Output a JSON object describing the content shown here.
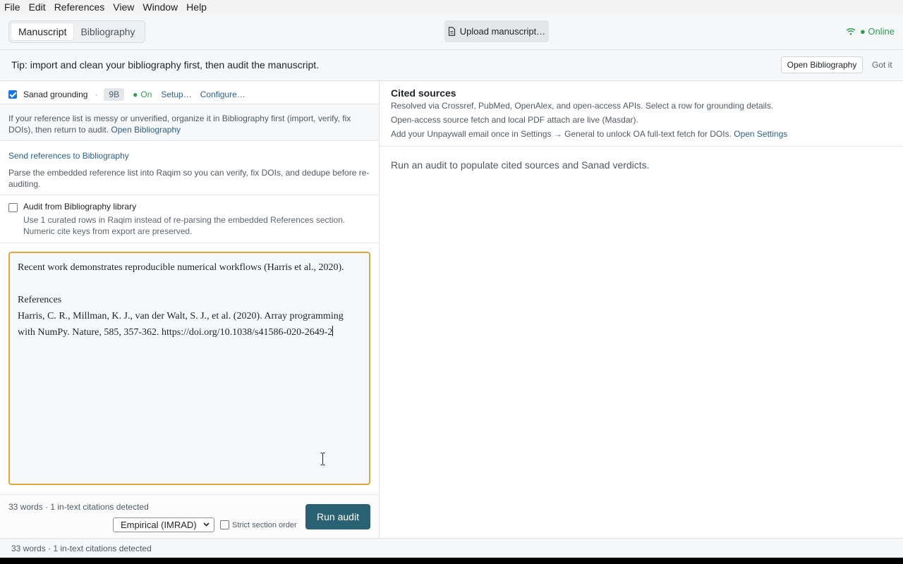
{
  "menu": [
    "File",
    "Edit",
    "References",
    "View",
    "Window",
    "Help"
  ],
  "tabs": {
    "manuscript": "Manuscript",
    "bibliography": "Bibliography"
  },
  "toolbar": {
    "upload_label": "Upload manuscript…",
    "status": "● Online"
  },
  "tip": {
    "text": "Tip: import and clean your bibliography first, then audit the manuscript.",
    "open_bib": "Open Bibliography",
    "got_it": "Got it"
  },
  "sanad": {
    "label": "Sanad grounding",
    "sep": "·",
    "model": "9B",
    "on_dot": "●",
    "on_text": "On",
    "setup": "Setup…",
    "configure": "Configure…",
    "checked": true
  },
  "messy": {
    "text": "If your reference list is messy or unverified, organize it in Bibliography first (import, verify, fix DOIs), then return to audit.",
    "link": "Open Bibliography"
  },
  "send": {
    "title": "Send references to Bibliography",
    "desc": "Parse the embedded reference list into Raqim so you can verify, fix DOIs, and dedupe before re-auditing."
  },
  "audit_lib": {
    "label": "Audit from Bibliography library",
    "desc": "Use 1 curated rows in Raqim instead of re-parsing the embedded References section. Numeric cite keys from export are preserved.",
    "checked": false
  },
  "editor": {
    "line1": "Recent work demonstrates reproducible numerical workflows (Harris et al., 2020).",
    "line2": "References",
    "line3": "Harris, C. R., Millman, K. J., van der Walt, S. J., et al. (2020). Array programming with NumPy. Nature, 585, 357-362. https://doi.org/10.1038/s41586-020-2649-2"
  },
  "footer": {
    "count": "33 words · 1 in-text citations detected",
    "select_value": "Empirical (IMRAD)",
    "strict_label": "Strict section order",
    "run_label": "Run audit"
  },
  "cited": {
    "title": "Cited sources",
    "line1": "Resolved via Crossref, PubMed, OpenAlex, and open-access APIs. Select a row for grounding details.",
    "line2": "Open-access source fetch and local PDF attach are live (Masdar).",
    "line3": "Add your Unpaywall email once in Settings → General to unlock OA full-text fetch for DOIs.",
    "settings_link": "Open Settings",
    "empty": "Run an audit to populate cited sources and Sanad verdicts."
  },
  "statusbar": {
    "text": "33 words · 1 in-text citations detected"
  },
  "colors": {
    "accent": "#2b6273",
    "online": "#2e9e4f",
    "editor_border": "#e3a43a",
    "link": "#2b5f8a"
  }
}
